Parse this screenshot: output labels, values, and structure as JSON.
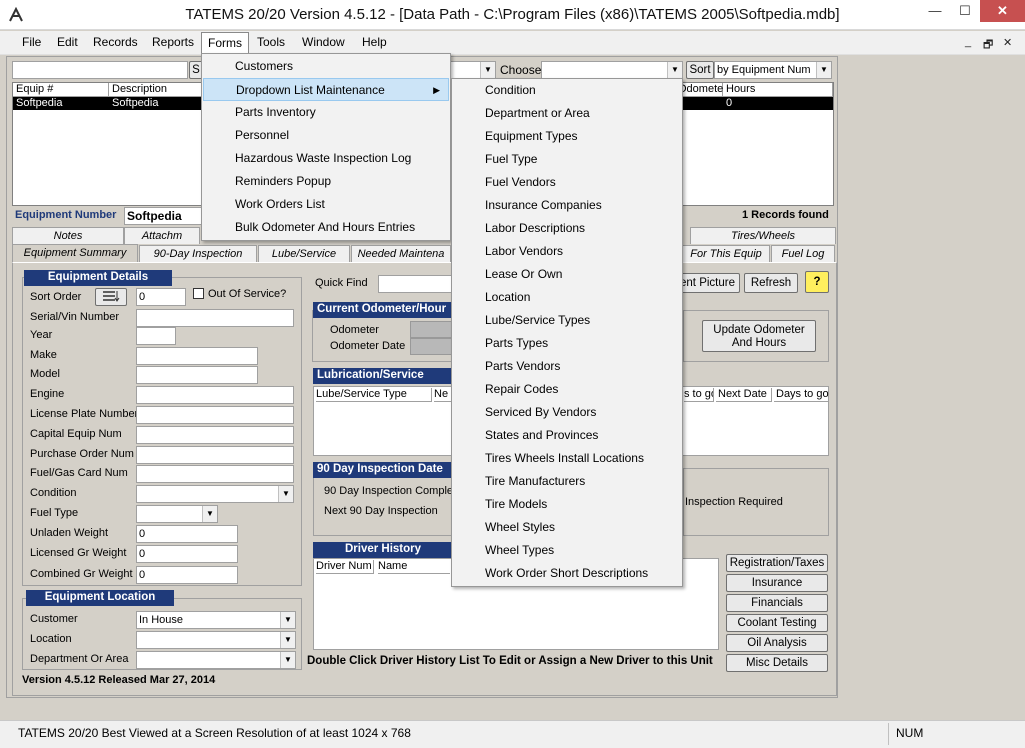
{
  "window": {
    "title": "TATEMS 20/20 Version 4.5.12 - [Data Path - C:\\Program Files (x86)\\TATEMS 2005\\Softpedia.mdb]",
    "minimize": "—",
    "maximize": "☐",
    "close": "✕"
  },
  "menubar": {
    "items": [
      "File",
      "Edit",
      "Records",
      "Reports",
      "Forms",
      "Tools",
      "Window",
      "Help"
    ],
    "mdi": {
      "minimize": "_",
      "restore": "🗗",
      "close": "✕"
    }
  },
  "toolbar": {
    "search_value": "",
    "search_btn": "S",
    "choose_label": "Choose",
    "choose_value": "",
    "sort_label": "Sort",
    "sort_value": "by Equipment Num"
  },
  "listview": {
    "columns": [
      "Equip #",
      "Description",
      "Odometer",
      "Hours"
    ],
    "rows": [
      {
        "equip": "Softpedia",
        "description": "Softpedia",
        "hours": "0"
      }
    ]
  },
  "equipment_number": {
    "label": "Equipment Number",
    "value": "Softpedia",
    "records_found": "1 Records found"
  },
  "tabs": {
    "row1": [
      "Notes",
      "Attachm",
      "Tires/Wheels"
    ],
    "row2": [
      "Equipment Summary",
      "90-Day Inspection",
      "Lube/Service",
      "Needed Maintena",
      "For This Equip",
      "Fuel Log"
    ]
  },
  "equipment_details": {
    "header": "Equipment Details",
    "sort_order_label": "Sort Order",
    "sort_order_value": "0",
    "out_of_service": "Out Of Service?",
    "fields": [
      "Serial/Vin Number",
      "Year",
      "Make",
      "Model",
      "Engine",
      "License Plate Number",
      "Capital Equip Num",
      "Purchase Order Num",
      "Fuel/Gas Card Num",
      "Condition",
      "Fuel Type",
      "Unladen Weight",
      "Licensed Gr Weight",
      "Combined Gr Weight"
    ],
    "unladen_weight": "0",
    "licensed_gr_weight": "0",
    "combined_gr_weight": "0"
  },
  "equipment_location": {
    "header": "Equipment Location",
    "customer_label": "Customer",
    "customer_value": "In House",
    "location_label": "Location",
    "department_label": "Department Or Area"
  },
  "version_text": "Version 4.5.12 Released Mar 27, 2014",
  "quick_find": {
    "label": "Quick Find",
    "value": ""
  },
  "buttons": {
    "picture": "ent Picture",
    "refresh": "Refresh",
    "help": "?",
    "update_odometer_line1": "Update Odometer",
    "update_odometer_line2": "And  Hours"
  },
  "odometer": {
    "header": "Current Odometer/Hour",
    "odometer_label": "Odometer",
    "odometer_date_label": "Odometer Date"
  },
  "lubrication": {
    "header": "Lubrication/Service",
    "columns": [
      "Lube/Service Type",
      "Ne",
      "s to go",
      "Next Date",
      "Days to go"
    ]
  },
  "inspection": {
    "header": "90 Day Inspection Date",
    "completed_label": "90 Day Inspection Comple",
    "next_label": "Next 90 Day Inspection",
    "required_text": "Inspection Required"
  },
  "driver_history": {
    "header": "Driver History",
    "columns": [
      "Driver Num",
      "Name"
    ],
    "hint": "Double Click Driver History List To Edit or Assign a New Driver to this Unit"
  },
  "side_buttons": [
    "Registration/Taxes",
    "Insurance",
    "Financials",
    "Coolant Testing",
    "Oil Analysis",
    "Misc Details"
  ],
  "forms_menu": {
    "items": [
      "Customers",
      "Dropdown List Maintenance",
      "Parts Inventory",
      "Personnel",
      "Hazardous Waste Inspection Log",
      "Reminders Popup",
      "Work Orders List",
      "Bulk Odometer And Hours Entries"
    ],
    "submenu_arrow": "▶"
  },
  "dropdown_submenu": {
    "items": [
      "Condition",
      "Department or Area",
      "Equipment Types",
      "Fuel Type",
      "Fuel Vendors",
      "Insurance Companies",
      "Labor Descriptions",
      "Labor Vendors",
      "Lease Or Own",
      "Location",
      "Lube/Service Types",
      "Parts Types",
      "Parts Vendors",
      "Repair Codes",
      "Serviced By Vendors",
      "States and Provinces",
      "Tires Wheels Install Locations",
      "Tire Manufacturers",
      "Tire Models",
      "Wheel Styles",
      "Wheel Types",
      "Work Order Short Descriptions"
    ]
  },
  "statusbar": {
    "message": "TATEMS 20/20 Best Viewed at a Screen Resolution of at least 1024 x 768",
    "num": "NUM"
  }
}
